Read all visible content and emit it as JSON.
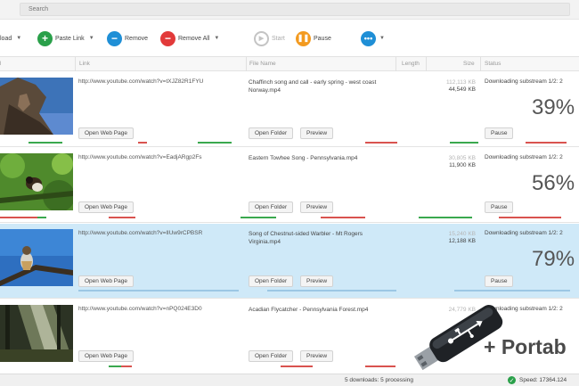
{
  "search": {
    "placeholder": "Search"
  },
  "toolbar": {
    "download_label": "load",
    "paste_link_label": "Paste Link",
    "remove_label": "Remove",
    "remove_all_label": "Remove All",
    "start_label": "Start",
    "pause_label": "Pause"
  },
  "columns": {
    "link": "Link",
    "file_name": "File Name",
    "length": "Length",
    "size": "Size",
    "status": "Status"
  },
  "rows": [
    {
      "url": "http://www.youtube.com/watch?v=tXJZ82R1FYU",
      "file_name": "Chaffinch song and call - early spring - west coast Norway.mp4",
      "downloaded": "112,113 KB",
      "total": "44,549 KB",
      "status": "Downloading substream 1/2: 2",
      "percent": "39%",
      "open_web_page": "Open Web Page",
      "open_folder": "Open Folder",
      "preview": "Preview",
      "pause": "Pause",
      "progress": 0.39
    },
    {
      "url": "http://www.youtube.com/watch?v=EadjARgp2Fs",
      "file_name": "Eastern Towhee Song - Pennsylvania.mp4",
      "downloaded": "30,805 KB",
      "total": "11,900 KB",
      "status": "Downloading substream 1/2: 2",
      "percent": "56%",
      "open_web_page": "Open Web Page",
      "open_folder": "Open Folder",
      "preview": "Preview",
      "pause": "Pause",
      "progress": 0.56
    },
    {
      "url": "http://www.youtube.com/watch?v=lIUw9rCPBSR",
      "file_name": "Song of Chestnut-sided Warbler - Mt Rogers Virginia.mp4",
      "downloaded": "15,240 KB",
      "total": "12,188 KB",
      "status": "Downloading substream 1/2: 2",
      "percent": "79%",
      "open_web_page": "Open Web Page",
      "open_folder": "Open Folder",
      "preview": "Preview",
      "pause": "Pause",
      "progress": 0.79
    },
    {
      "url": "http://www.youtube.com/watch?v=nPQ024E3D0",
      "file_name": "Acadian Flycatcher - Pennsylvania Forest.mp4",
      "downloaded": "24,779 KB",
      "total": "",
      "status": "Downloading substream 1/2: 2",
      "percent": "",
      "open_web_page": "Open Web Page",
      "open_folder": "Open Folder",
      "preview": "Preview",
      "pause": "",
      "progress": 0.0
    }
  ],
  "footer": {
    "status": "5 downloads: 5 processing",
    "speed": "Speed: 17364.124"
  },
  "overlay": {
    "portable_text": "+ Portab"
  },
  "colors": {
    "green": "#2aa04a",
    "blue": "#1f8fd6",
    "red": "#e23a3a",
    "orange": "#f39a1f",
    "selected_row": "#cfe9f8"
  },
  "icons": [
    "paste-link-icon",
    "remove-icon",
    "remove-all-icon",
    "start-icon",
    "pause-icon",
    "more-icon",
    "usb-drive-icon",
    "speed-check-icon"
  ]
}
